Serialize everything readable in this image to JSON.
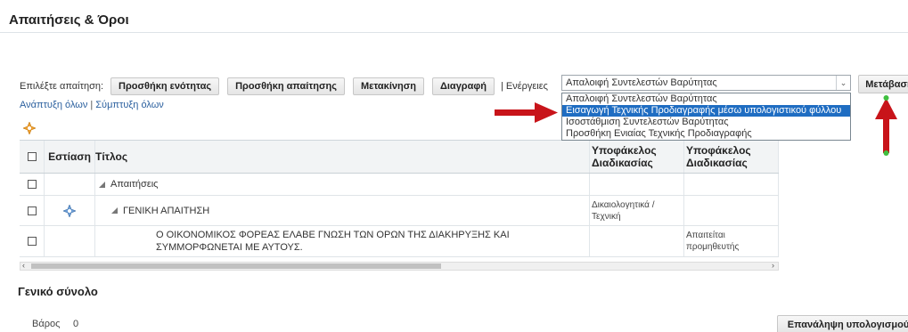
{
  "page": {
    "title": "Απαιτήσεις & Όροι"
  },
  "toolbar": {
    "select_label": "Επιλέξτε απαίτηση:",
    "add_section": "Προσθήκη ενότητας",
    "add_requirement": "Προσθήκη απαίτησης",
    "move": "Μετακίνηση",
    "delete": "Διαγραφή",
    "actions_label": "| Ενέργειες",
    "actions_selected": "Απαλοιφή Συντελεστών Βαρύτητας",
    "go": "Μετάβαση"
  },
  "dropdown": {
    "options": [
      "Απαλοιφή Συντελεστών Βαρύτητας",
      "Εισαγωγή Τεχνικής Προδιαγραφής μέσω υπολογιστικού φύλλου",
      "Ισοστάθμιση Συντελεστών Βαρύτητας",
      "Προσθήκη Ενιαίας Τεχνικής Προδιαγραφής"
    ],
    "highlighted": "Εισαγωγή Τεχνικής Προδιαγραφής μέσω υπολογιστικού φύλλου"
  },
  "links": {
    "expand_all": "Ανάπτυξη όλων",
    "separator": "|",
    "collapse_all": "Σύμπτυξη όλων"
  },
  "table": {
    "headers": {
      "focus": "Εστίαση",
      "title": "Τίτλος",
      "folder1": "Υποφάκελος Διαδικασίας",
      "folder2": "Υποφάκελος Διαδικασίας"
    },
    "rows": [
      {
        "title": "Απαιτήσεις",
        "folder1": "",
        "folder2": ""
      },
      {
        "title": "ΓΕΝΙΚΗ ΑΠΑΙΤΗΣΗ",
        "folder1": "Δικαιολογητικά / Τεχνική",
        "folder2": ""
      },
      {
        "title": "Ο ΟΙΚΟΝΟΜΙΚΟΣ ΦΟΡΕΑΣ ΕΛΑΒΕ ΓΝΩΣΗ ΤΩΝ ΟΡΩΝ ΤΗΣ ΔΙΑΚΗΡΥΞΗΣ ΚΑΙ ΣΥΜΜΟΡΦΩΝΕΤΑΙ ΜΕ ΑΥΤΟΥΣ.",
        "folder1": "",
        "folder2": "Απαιτείται προμηθευτής"
      }
    ]
  },
  "summary": {
    "title": "Γενικό σύνολο",
    "weight_label": "Βάρος",
    "weight_value": "0",
    "recalc": "Επανάληψη υπολογισμού"
  },
  "icons": {
    "focus": "focus-target-icon",
    "annotation_arrows": "red-arrow-icon"
  },
  "colors": {
    "highlight": "#1f6dc2",
    "arrow": "#c8141a",
    "link": "#2a5f9e"
  }
}
